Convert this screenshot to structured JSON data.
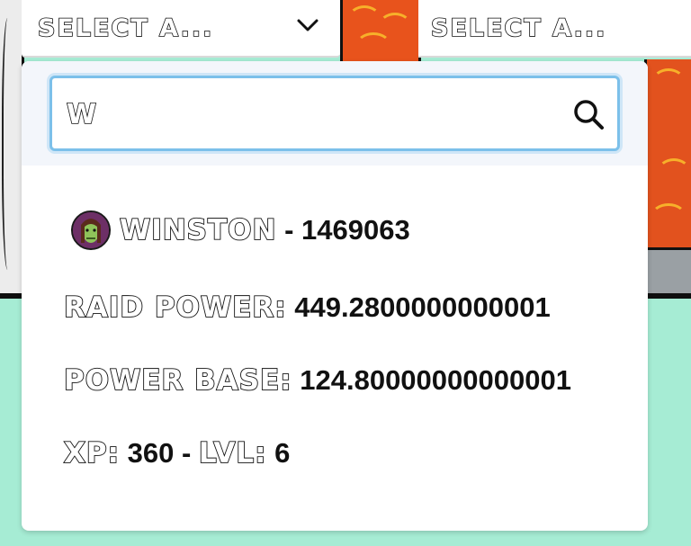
{
  "selects": [
    {
      "label": "SELECT A...",
      "has_chevron": true
    },
    {
      "label": "SELECT A...",
      "has_chevron": false
    }
  ],
  "search": {
    "value": "W",
    "icon": "search-icon"
  },
  "result": {
    "name": "WINSTON",
    "separator": " - ",
    "id": "1469063",
    "avatar": "avatar-icon"
  },
  "stats": {
    "raid_power_label": "RAID POWER:",
    "raid_power_value": " 449.2800000000001",
    "power_base_label": "POWER BASE:",
    "power_base_value": " 124.80000000000001",
    "xp_label": "XP:",
    "xp_value": " 360 - ",
    "lvl_label": "LVL:",
    "lvl_value": " 6"
  },
  "colors": {
    "backdrop": "#a6ecd4",
    "focus_border": "#7cc0ea",
    "panel_orange": "#e8531c"
  }
}
